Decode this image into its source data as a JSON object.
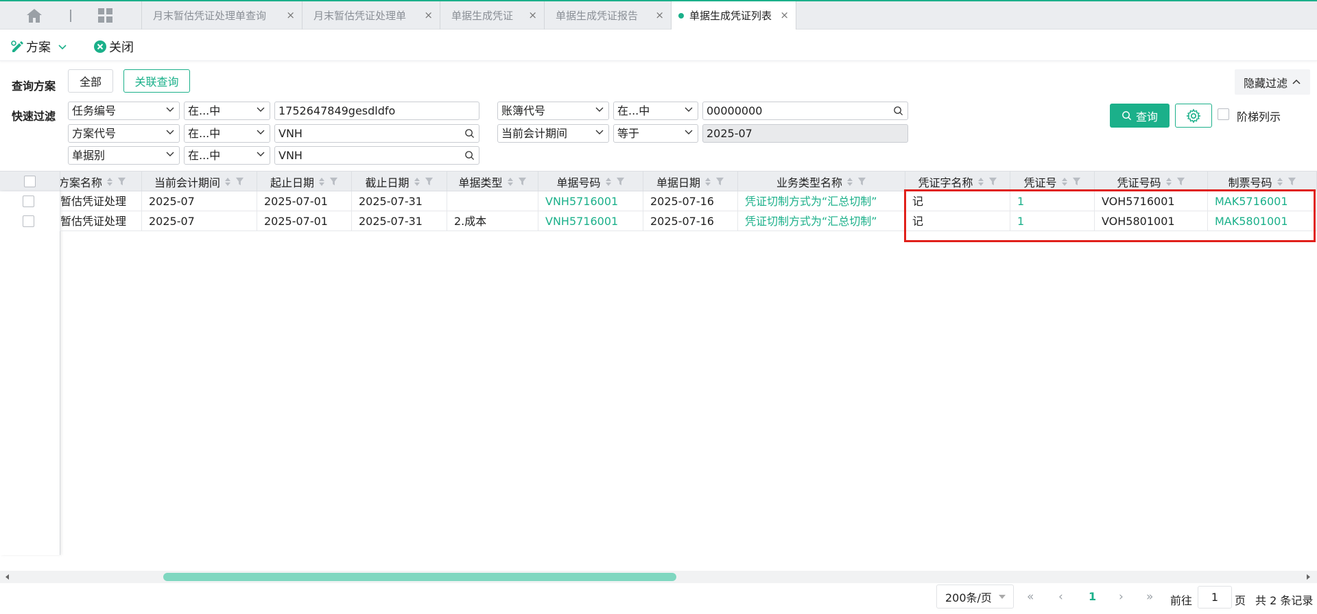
{
  "tabs": [
    {
      "label": "月末暂估凭证处理单查询"
    },
    {
      "label": "月末暂估凭证处理单"
    },
    {
      "label": "单据生成凭证"
    },
    {
      "label": "单据生成凭证报告"
    },
    {
      "label": "单据生成凭证列表"
    }
  ],
  "tab_close": "×",
  "toolbar": {
    "scheme_label": "方案",
    "close_label": "关闭"
  },
  "filter": {
    "query_scheme_label": "查询方案",
    "all_button": "全部",
    "related_query_button": "关联查询",
    "quick_filter_label": "快速过滤",
    "hide_filter": "隐藏过滤",
    "rows": [
      {
        "field": "任务编号",
        "op": "在...中",
        "value": "1752647849gesdldfo"
      },
      {
        "field": "方案代号",
        "op": "在...中",
        "value": "VNH"
      },
      {
        "field": "单据别",
        "op": "在...中",
        "value": "VNH"
      }
    ],
    "rows2": [
      {
        "field": "账簿代号",
        "op": "在...中",
        "value": "00000000"
      },
      {
        "field": "当前会计期间",
        "op": "等于",
        "value": "2025-07"
      }
    ],
    "query_button": "查询",
    "tiered_label": "阶梯列示"
  },
  "table": {
    "columns": [
      "方案名称",
      "当前会计期间",
      "起止日期",
      "截止日期",
      "单据类型",
      "单据号码",
      "单据日期",
      "业务类型名称",
      "凭证字名称",
      "凭证号",
      "凭证号码",
      "制票号码"
    ],
    "rows": [
      [
        "月末暂估凭证处理",
        "2025-07",
        "2025-07-01",
        "2025-07-31",
        "",
        "VNH5716001",
        "2025-07-16",
        "凭证切制方式为“汇总切制”",
        "记",
        "1",
        "VOH5716001",
        "MAK5716001"
      ],
      [
        "月末暂估凭证处理",
        "2025-07",
        "2025-07-01",
        "2025-07-31",
        "2.成本",
        "VNH5716001",
        "2025-07-16",
        "凭证切制方式为“汇总切制”",
        "记",
        "1",
        "VOH5801001",
        "MAK5801001"
      ]
    ]
  },
  "pagination": {
    "page_size": "200条/页",
    "current_page": "1",
    "goto_label": "前往",
    "goto_value": "1",
    "page_unit": "页",
    "total": "共 2 条记录"
  },
  "colors": {
    "accent": "#1bb08a",
    "highlight": "#e0201a"
  }
}
